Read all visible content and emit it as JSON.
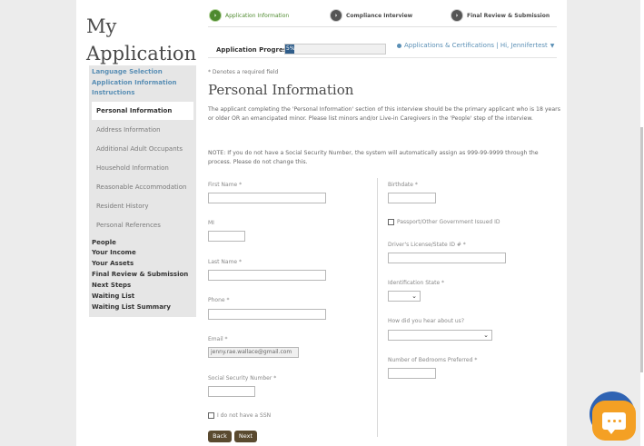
{
  "header": {
    "title": "My Application",
    "steps": [
      {
        "label": "Application Information",
        "state": "active"
      },
      {
        "label": "Compliance Interview",
        "state": "inactive"
      },
      {
        "label": "Final Review & Submission",
        "state": "inactive"
      }
    ],
    "progress_label": "Application Progress",
    "progress_value": "5%",
    "account_text": "Applications & Certifications | Hi, Jennifertest"
  },
  "sidebar": {
    "links": [
      "Language Selection",
      "Application Information",
      "Instructions"
    ],
    "subitems": [
      "Personal Information",
      "Address Information",
      "Additional Adult Occupants",
      "Household Information",
      "Reasonable Accommodation",
      "Resident History",
      "Personal References"
    ],
    "main_items": [
      "People",
      "Your Income",
      "Your Assets",
      "Final Review & Submission",
      "Next Steps",
      "Waiting List",
      "Waiting List Summary"
    ]
  },
  "content": {
    "required_note": "* Denotes a required field",
    "section_title": "Personal Information",
    "intro": "The applicant completing the 'Personal Information' section of this interview should be the primary applicant who is 18 years or older OR an emancipated minor. Please list minors and/or Live-in Caregivers in the 'People' step of the interview.",
    "note": "NOTE:  If you do not have a Social Security Number, the system will automatically assign as 999-99-9999 through the process.  Please do not change this."
  },
  "form": {
    "first_name_label": "First Name *",
    "mi_label": "MI",
    "last_name_label": "Last Name *",
    "phone_label": "Phone *",
    "email_label": "Email *",
    "email_value": "jenny.rae.wallace@gmail.com",
    "ssn_label": "Social Security Number *",
    "no_ssn_label": "I do not have a SSN",
    "birthdate_label": "Birthdate *",
    "passport_label": "Passport/Other Government Issued ID",
    "license_label": "Driver's License/State ID # *",
    "id_state_label": "Identification State *",
    "hear_label": "How did you hear about us?",
    "bedrooms_label": "Number of Bedrooms Preferred *",
    "back_label": "Back",
    "next_label": "Next"
  },
  "colors": {
    "accent_green": "#4e8a2e",
    "link_blue": "#5a8fb5",
    "progress_blue": "#2f5d8a",
    "button_brown": "#5a4a2f",
    "chat_orange": "#f4a024"
  }
}
